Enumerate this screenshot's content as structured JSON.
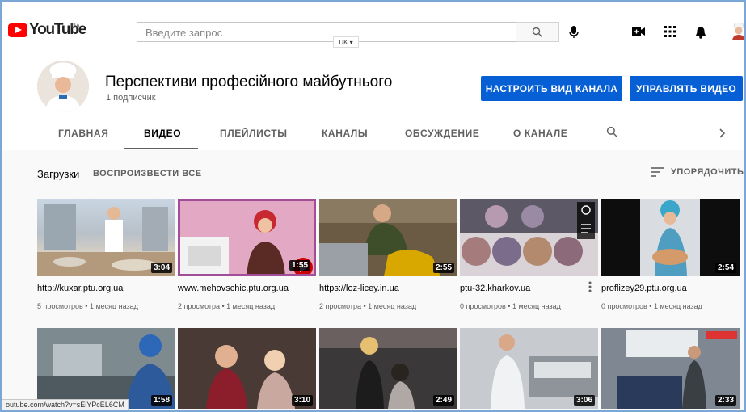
{
  "header": {
    "logo_text": "YouTube",
    "country_code": "UA",
    "search_placeholder": "Введите запрос",
    "keyboard_lang": "UK"
  },
  "channel": {
    "name": "Перспективи професійного майбутнього",
    "subscribers": "1 подписчик",
    "customize_button": "НАСТРОИТЬ ВИД КАНАЛА",
    "manage_button": "УПРАВЛЯТЬ ВИДЕО"
  },
  "tabs": [
    "ГЛАВНАЯ",
    "ВИДЕО",
    "ПЛЕЙЛИСТЫ",
    "КАНАЛЫ",
    "ОБСУЖДЕНИЕ",
    "О КАНАЛЕ"
  ],
  "active_tab": "ВИДЕО",
  "uploads": {
    "title": "Загрузки",
    "play_all": "ВОСПРОИЗВЕСТИ ВСЕ",
    "sort_label": "УПОРЯДОЧИТЬ"
  },
  "videos": [
    {
      "title": "http://kuxar.ptu.org.ua",
      "meta": "5 просмотров • 1 месяц назад",
      "duration": "3:04"
    },
    {
      "title": "www.mehovschic.ptu.org.ua",
      "meta": "2 просмотра • 1 месяц назад",
      "duration": "1:55"
    },
    {
      "title": "https://loz-licey.in.ua",
      "meta": "2 просмотра • 1 месяц назад",
      "duration": "2:55"
    },
    {
      "title": "ptu-32.kharkov.ua",
      "meta": "0 просмотров • 1 месяц назад",
      "duration": ""
    },
    {
      "title": "proflizey29.ptu.org.ua",
      "meta": "0 просмотров • 1 месяц назад",
      "duration": "2:54"
    }
  ],
  "videos_row2": [
    {
      "duration": "1:58"
    },
    {
      "duration": "3:10"
    },
    {
      "duration": "2:49"
    },
    {
      "duration": "3:06"
    },
    {
      "duration": "2:33"
    }
  ],
  "status_url": "outube.com/watch?v=sEiYPcEL6CM",
  "colors": {
    "brand_red": "#ff0000",
    "accent_blue": "#065fd4"
  }
}
